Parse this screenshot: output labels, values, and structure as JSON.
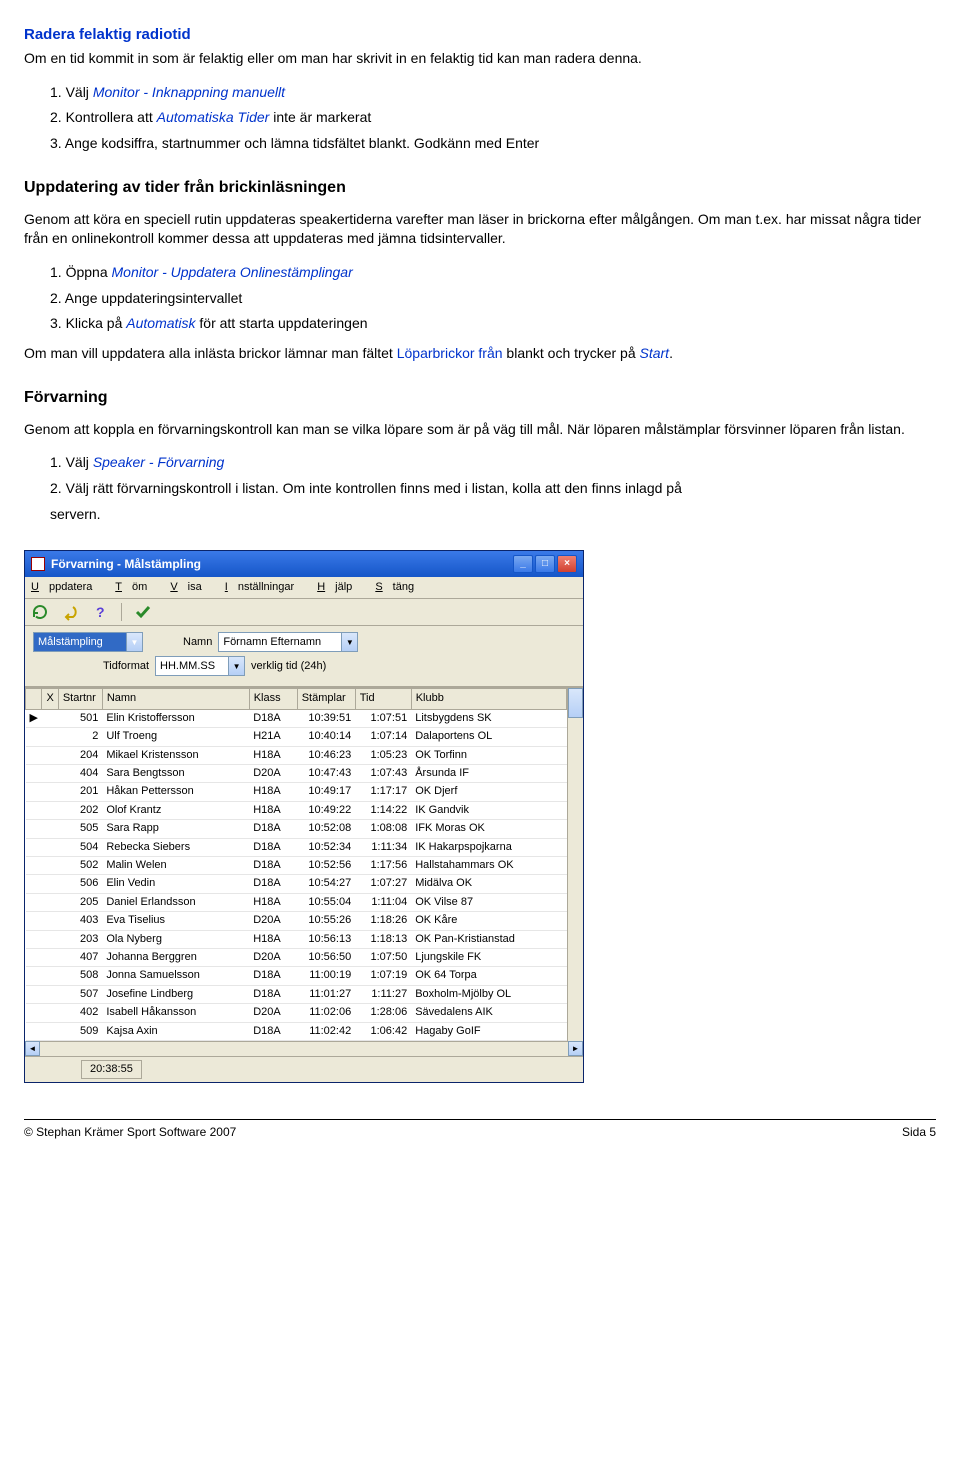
{
  "heading1": "Radera felaktig radiotid",
  "intro1": "Om en tid kommit in som är felaktig eller om man har skrivit in en felaktig tid kan man radera denna.",
  "list1": {
    "n1": "1. Välj ",
    "i1a": "Monitor - Inknappning manuellt",
    "n2": "2. Kontrollera att ",
    "i2a": "Automatiska Tider",
    "n2b": " inte är markerat",
    "n3": "3. Ange kodsiffra, startnummer och lämna tidsfältet blankt. Godkänn med Enter"
  },
  "heading2": "Uppdatering av tider från brickinläsningen",
  "intro2": "Genom att köra en speciell rutin uppdateras speakertiderna varefter man läser in brickorna efter målgången. Om man t.ex. har missat några tider från en onlinekontroll kommer dessa att uppdateras med jämna tidsintervaller.",
  "list2": {
    "n1": "1. Öppna ",
    "i1a": "Monitor - Uppdatera Onlinestämplingar",
    "n2": "2. Ange uppdateringsintervallet",
    "n3": "3. Klicka på ",
    "i3a": "Automatisk",
    "n3b": " för att starta uppdateringen"
  },
  "para3a": "Om man vill uppdatera alla inlästa brickor lämnar man fältet ",
  "para3link": "Löparbrickor från",
  "para3b": " blankt och trycker på ",
  "para3link2": "Start",
  "para3c": ".",
  "heading3": "Förvarning",
  "intro3": "Genom att koppla en förvarningskontroll kan man se vilka löpare som är på väg till mål. När löparen målstämplar försvinner löparen från listan.",
  "list3": {
    "n1": "1. Välj ",
    "i1a": "Speaker - Förvarning",
    "n2": "2. Välj rätt förvarningskontroll i listan. Om inte kontrollen finns med i listan, kolla att den finns inlagd på",
    "n3": "servern."
  },
  "window": {
    "title": "Förvarning - Målstämpling",
    "menu": {
      "m1": "Uppdatera",
      "m2": "Töm",
      "m3": "Visa",
      "m4": "Inställningar",
      "m5": "Hjälp",
      "m6": "Stäng"
    },
    "form": {
      "combo1": "Målstämpling",
      "lbl_namn": "Namn",
      "combo_namn": "Förnamn Efternamn",
      "lbl_tidformat": "Tidformat",
      "combo_tid": "HH.MM.SS",
      "lbl_verklig": "verklig tid (24h)"
    },
    "headers": {
      "x": "X",
      "startnr": "Startnr",
      "namn": "Namn",
      "klass": "Klass",
      "stamplar": "Stämplar",
      "tid": "Tid",
      "klubb": "Klubb"
    },
    "rows": [
      {
        "s": "501",
        "n": "Elin Kristoffersson",
        "k": "D18A",
        "st": "10:39:51",
        "t": "1:07:51",
        "kl": "Litsbygdens SK"
      },
      {
        "s": "2",
        "n": "Ulf Troeng",
        "k": "H21A",
        "st": "10:40:14",
        "t": "1:07:14",
        "kl": "Dalaportens OL"
      },
      {
        "s": "204",
        "n": "Mikael Kristensson",
        "k": "H18A",
        "st": "10:46:23",
        "t": "1:05:23",
        "kl": "OK Torfinn"
      },
      {
        "s": "404",
        "n": "Sara Bengtsson",
        "k": "D20A",
        "st": "10:47:43",
        "t": "1:07:43",
        "kl": "Årsunda IF"
      },
      {
        "s": "201",
        "n": "Håkan Pettersson",
        "k": "H18A",
        "st": "10:49:17",
        "t": "1:17:17",
        "kl": "OK Djerf"
      },
      {
        "s": "202",
        "n": "Olof Krantz",
        "k": "H18A",
        "st": "10:49:22",
        "t": "1:14:22",
        "kl": "IK Gandvik"
      },
      {
        "s": "505",
        "n": "Sara Rapp",
        "k": "D18A",
        "st": "10:52:08",
        "t": "1:08:08",
        "kl": "IFK Moras OK"
      },
      {
        "s": "504",
        "n": "Rebecka Siebers",
        "k": "D18A",
        "st": "10:52:34",
        "t": "1:11:34",
        "kl": "IK Hakarpspojkarna"
      },
      {
        "s": "502",
        "n": "Malin Welen",
        "k": "D18A",
        "st": "10:52:56",
        "t": "1:17:56",
        "kl": "Hallstahammars OK"
      },
      {
        "s": "506",
        "n": "Elin Vedin",
        "k": "D18A",
        "st": "10:54:27",
        "t": "1:07:27",
        "kl": "Midälva OK"
      },
      {
        "s": "205",
        "n": "Daniel Erlandsson",
        "k": "H18A",
        "st": "10:55:04",
        "t": "1:11:04",
        "kl": "OK Vilse 87"
      },
      {
        "s": "403",
        "n": "Eva Tiselius",
        "k": "D20A",
        "st": "10:55:26",
        "t": "1:18:26",
        "kl": "OK Kåre"
      },
      {
        "s": "203",
        "n": "Ola Nyberg",
        "k": "H18A",
        "st": "10:56:13",
        "t": "1:18:13",
        "kl": "OK Pan-Kristianstad"
      },
      {
        "s": "407",
        "n": "Johanna Berggren",
        "k": "D20A",
        "st": "10:56:50",
        "t": "1:07:50",
        "kl": "Ljungskile FK"
      },
      {
        "s": "508",
        "n": "Jonna Samuelsson",
        "k": "D18A",
        "st": "11:00:19",
        "t": "1:07:19",
        "kl": "OK 64 Torpa"
      },
      {
        "s": "507",
        "n": "Josefine Lindberg",
        "k": "D18A",
        "st": "11:01:27",
        "t": "1:11:27",
        "kl": "Boxholm-Mjölby OL"
      },
      {
        "s": "402",
        "n": "Isabell Håkansson",
        "k": "D20A",
        "st": "11:02:06",
        "t": "1:28:06",
        "kl": "Sävedalens AIK"
      },
      {
        "s": "509",
        "n": "Kajsa Axin",
        "k": "D18A",
        "st": "11:02:42",
        "t": "1:06:42",
        "kl": "Hagaby GoIF"
      }
    ],
    "status": "20:38:55"
  },
  "footer": {
    "left": "© Stephan Krämer Sport Software 2007",
    "right": "Sida 5"
  }
}
